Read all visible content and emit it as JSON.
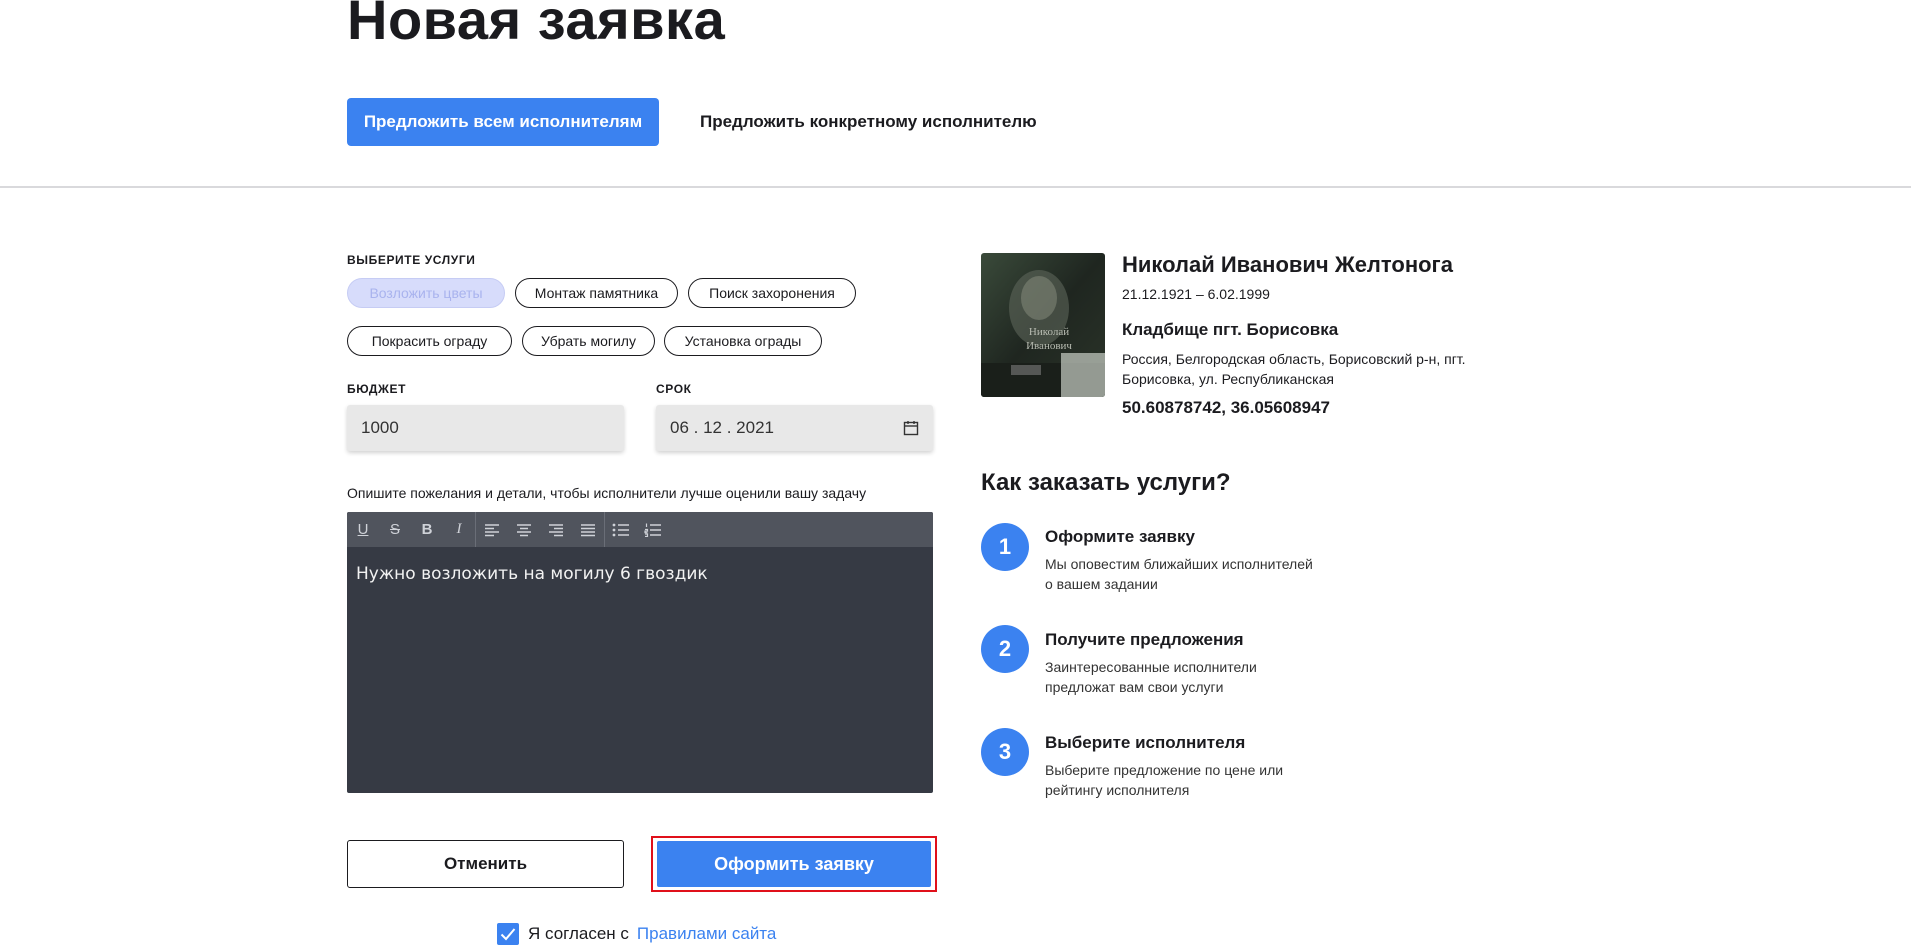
{
  "page": {
    "title": "Новая заявка"
  },
  "tabs": {
    "active": "Предложить всем исполнителям",
    "other": "Предложить конкретному исполнителю"
  },
  "services": {
    "label": "ВЫБЕРИТЕ УСЛУГИ",
    "chips": [
      "Возложить цветы",
      "Монтаж памятника",
      "Поиск захоронения",
      "Покрасить ограду",
      "Убрать могилу",
      "Установка ограды"
    ]
  },
  "budget": {
    "label": "БЮДЖЕТ",
    "value": "1000"
  },
  "deadline": {
    "label": "СРОК",
    "value": "06 . 12 . 2021"
  },
  "description": {
    "hint": "Опишите пожелания и детали, чтобы исполнители лучше оценили вашу задачу",
    "text": "Нужно возложить на могилу 6 гвоздик",
    "toolbar": {
      "underline": "U",
      "strike": "S",
      "bold": "B",
      "italic": "I"
    }
  },
  "actions": {
    "cancel": "Отменить",
    "submit": "Оформить заявку"
  },
  "agreement": {
    "text": "Я согласен с",
    "link": "Правилами сайта"
  },
  "person": {
    "name": "Николай Иванович Желтонога",
    "dates": "21.12.1921 – 6.02.1999",
    "cemetery": "Кладбище пгт. Борисовка",
    "address": "Россия, Белгородская область, Борисовский р-н, пгт. Борисовка, ул. Республиканская",
    "coords": "50.60878742, 36.05608947",
    "photo_text": "Николай Иванович"
  },
  "how": {
    "title": "Как заказать услуги?",
    "steps": [
      {
        "num": "1",
        "title": "Оформите заявку",
        "desc": "Мы оповестим ближайших исполнителей о вашем задании"
      },
      {
        "num": "2",
        "title": "Получите предложения",
        "desc": "Заинтересованные исполнители предложат вам свои услуги"
      },
      {
        "num": "3",
        "title": "Выберите исполнителя",
        "desc": "Выберите предложение по цене или рейтингу исполнителя"
      }
    ]
  },
  "colors": {
    "accent": "#3b82f0",
    "highlight_border": "#e0101a",
    "editor_bg": "#363a44"
  }
}
